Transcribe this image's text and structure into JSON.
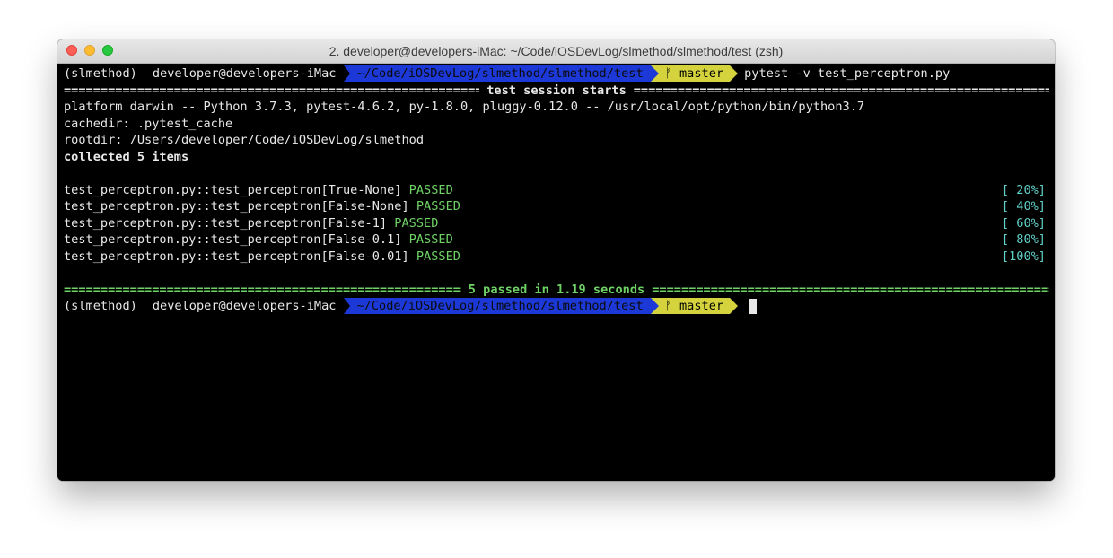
{
  "window": {
    "title": "2. developer@developers-iMac: ~/Code/iOSDevLog/slmethod/slmethod/test (zsh)"
  },
  "prompt": {
    "venv": "(slmethod)",
    "user_host": "developer@developers-iMac",
    "path": "~/Code/iOSDevLog/slmethod/slmethod/test",
    "branch_icon": "git-branch-icon",
    "branch_glyph": "ᚠ",
    "branch": "master"
  },
  "command": "pytest -v test_perceptron.py",
  "session": {
    "header": "test session starts",
    "platform": "platform darwin -- Python 3.7.3, pytest-4.6.2, py-1.8.0, pluggy-0.12.0 -- /usr/local/opt/python/bin/python3.7",
    "cachedir": "cachedir: .pytest_cache",
    "rootdir": "rootdir: /Users/developer/Code/iOSDevLog/slmethod",
    "collected": "collected 5 items"
  },
  "tests": [
    {
      "name": "test_perceptron.py::test_perceptron[True-None]",
      "status": "PASSED",
      "progress": "[ 20%]"
    },
    {
      "name": "test_perceptron.py::test_perceptron[False-None]",
      "status": "PASSED",
      "progress": "[ 40%]"
    },
    {
      "name": "test_perceptron.py::test_perceptron[False-1]",
      "status": "PASSED",
      "progress": "[ 60%]"
    },
    {
      "name": "test_perceptron.py::test_perceptron[False-0.1]",
      "status": "PASSED",
      "progress": "[ 80%]"
    },
    {
      "name": "test_perceptron.py::test_perceptron[False-0.01]",
      "status": "PASSED",
      "progress": "[100%]"
    }
  ],
  "summary": "5 passed in 1.19 seconds",
  "colors": {
    "path_segment": "#1c38d6",
    "git_segment": "#d4d33e",
    "passed": "#6ed265",
    "progress": "#5fd0c8"
  }
}
